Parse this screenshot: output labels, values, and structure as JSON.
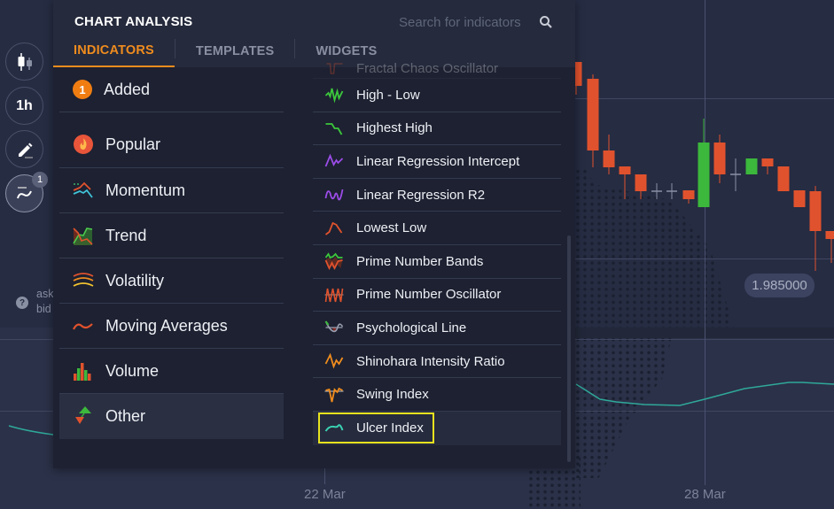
{
  "panel": {
    "title": "CHART ANALYSIS",
    "search": {
      "placeholder": "Search for indicators",
      "value": "",
      "icon": "search-icon"
    },
    "tabs": [
      {
        "label": "INDICATORS",
        "active": true
      },
      {
        "label": "TEMPLATES",
        "active": false
      },
      {
        "label": "WIDGETS",
        "active": false
      }
    ],
    "categories": [
      {
        "label": "Added",
        "badge": "1",
        "icon": "count-badge"
      },
      {
        "label": "Popular",
        "icon": "fire-icon"
      },
      {
        "label": "Momentum",
        "icon": "momentum-icon"
      },
      {
        "label": "Trend",
        "icon": "trend-icon"
      },
      {
        "label": "Volatility",
        "icon": "volatility-icon"
      },
      {
        "label": "Moving Averages",
        "icon": "moving-averages-icon"
      },
      {
        "label": "Volume",
        "icon": "volume-icon"
      },
      {
        "label": "Other",
        "icon": "other-icon",
        "active": true
      }
    ],
    "indicators": [
      {
        "label": "Fractal Chaos Oscillator",
        "icon": "fractal-chaos-icon"
      },
      {
        "label": "High - Low",
        "icon": "high-low-icon"
      },
      {
        "label": "Highest High",
        "icon": "highest-high-icon"
      },
      {
        "label": "Linear Regression Intercept",
        "icon": "linreg-intercept-icon"
      },
      {
        "label": "Linear Regression R2",
        "icon": "linreg-r2-icon"
      },
      {
        "label": "Lowest Low",
        "icon": "lowest-low-icon"
      },
      {
        "label": "Prime Number Bands",
        "icon": "prime-bands-icon"
      },
      {
        "label": "Prime Number Oscillator",
        "icon": "prime-oscillator-icon"
      },
      {
        "label": "Psychological Line",
        "icon": "psychological-line-icon"
      },
      {
        "label": "Shinohara Intensity Ratio",
        "icon": "shinohara-icon"
      },
      {
        "label": "Swing Index",
        "icon": "swing-index-icon"
      },
      {
        "label": "Ulcer Index",
        "icon": "ulcer-index-icon",
        "highlighted": true
      }
    ]
  },
  "toolbar": {
    "chart_type_icon": "candlestick-icon",
    "timeframe": "1h",
    "draw_icon": "pencil-icon",
    "indicators_icon": "indicators-icon",
    "indicators_count": "1"
  },
  "chart": {
    "price_label": "1.985000",
    "dates": [
      "22 Mar",
      "28 Mar"
    ],
    "ask_label": "ask",
    "bid_label": "bid",
    "help_icon": "?",
    "colors": {
      "up": "#3cb83c",
      "down": "#e0522d",
      "doji": "#8a90a4",
      "indicator_line": "#2fa89a",
      "accent": "#f08c1e",
      "highlight": "#e7e21f"
    }
  }
}
